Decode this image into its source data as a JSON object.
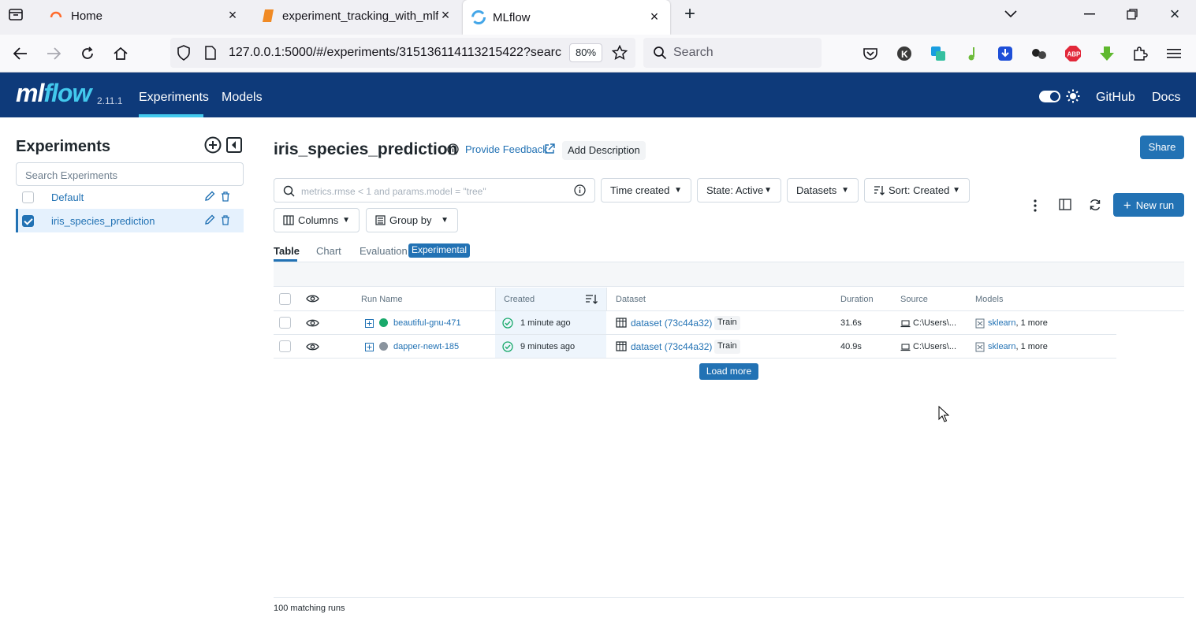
{
  "browser": {
    "tabs": [
      {
        "title": "Home"
      },
      {
        "title": "experiment_tracking_with_mlflc"
      },
      {
        "title": "MLflow"
      }
    ],
    "url": "127.0.0.1:5000/#/experiments/315136114113215422?searc",
    "zoom": "80%",
    "search_placeholder": "Search"
  },
  "header": {
    "logo_ml": "ml",
    "logo_flow": "flow",
    "version": "2.11.1",
    "nav": [
      "Experiments",
      "Models"
    ],
    "right_links": [
      "GitHub",
      "Docs"
    ],
    "accent_color": "#43c9ed",
    "bg_color": "#0e3a7a"
  },
  "sidebar": {
    "title": "Experiments",
    "search_placeholder": "Search Experiments",
    "experiments": [
      {
        "name": "Default",
        "checked": false
      },
      {
        "name": "iris_species_prediction",
        "checked": true
      }
    ]
  },
  "main": {
    "title": "iris_species_prediction",
    "feedback_label": "Provide Feedback",
    "add_description_label": "Add Description",
    "share_label": "Share",
    "filter_placeholder": "metrics.rmse < 1 and params.model = \"tree\"",
    "dropdowns": [
      "Time created",
      "State: Active",
      "Datasets",
      "Sort: Created"
    ],
    "columns_label": "Columns",
    "group_by_label": "Group by",
    "new_run_label": "New run",
    "view_tabs": [
      "Table",
      "Chart",
      "Evaluation"
    ],
    "experimental_badge": "Experimental",
    "load_more_label": "Load more",
    "matching_runs": "100 matching runs"
  },
  "table": {
    "columns": [
      "Run Name",
      "Created",
      "Dataset",
      "Duration",
      "Source",
      "Models"
    ],
    "rows": [
      {
        "run_name": "beautiful-gnu-471",
        "status_color": "#19a96b",
        "created": "1 minute ago",
        "dataset": "dataset (73c44a32)",
        "dataset_tag": "Train",
        "duration": "31.6s",
        "source": "C:\\Users\\...",
        "models_link": "sklearn",
        "models_more": ", 1 more"
      },
      {
        "run_name": "dapper-newt-185",
        "status_color": "#8a949e",
        "created": "9 minutes ago",
        "dataset": "dataset (73c44a32)",
        "dataset_tag": "Train",
        "duration": "40.9s",
        "source": "C:\\Users\\...",
        "models_link": "sklearn",
        "models_more": ", 1 more"
      }
    ]
  }
}
